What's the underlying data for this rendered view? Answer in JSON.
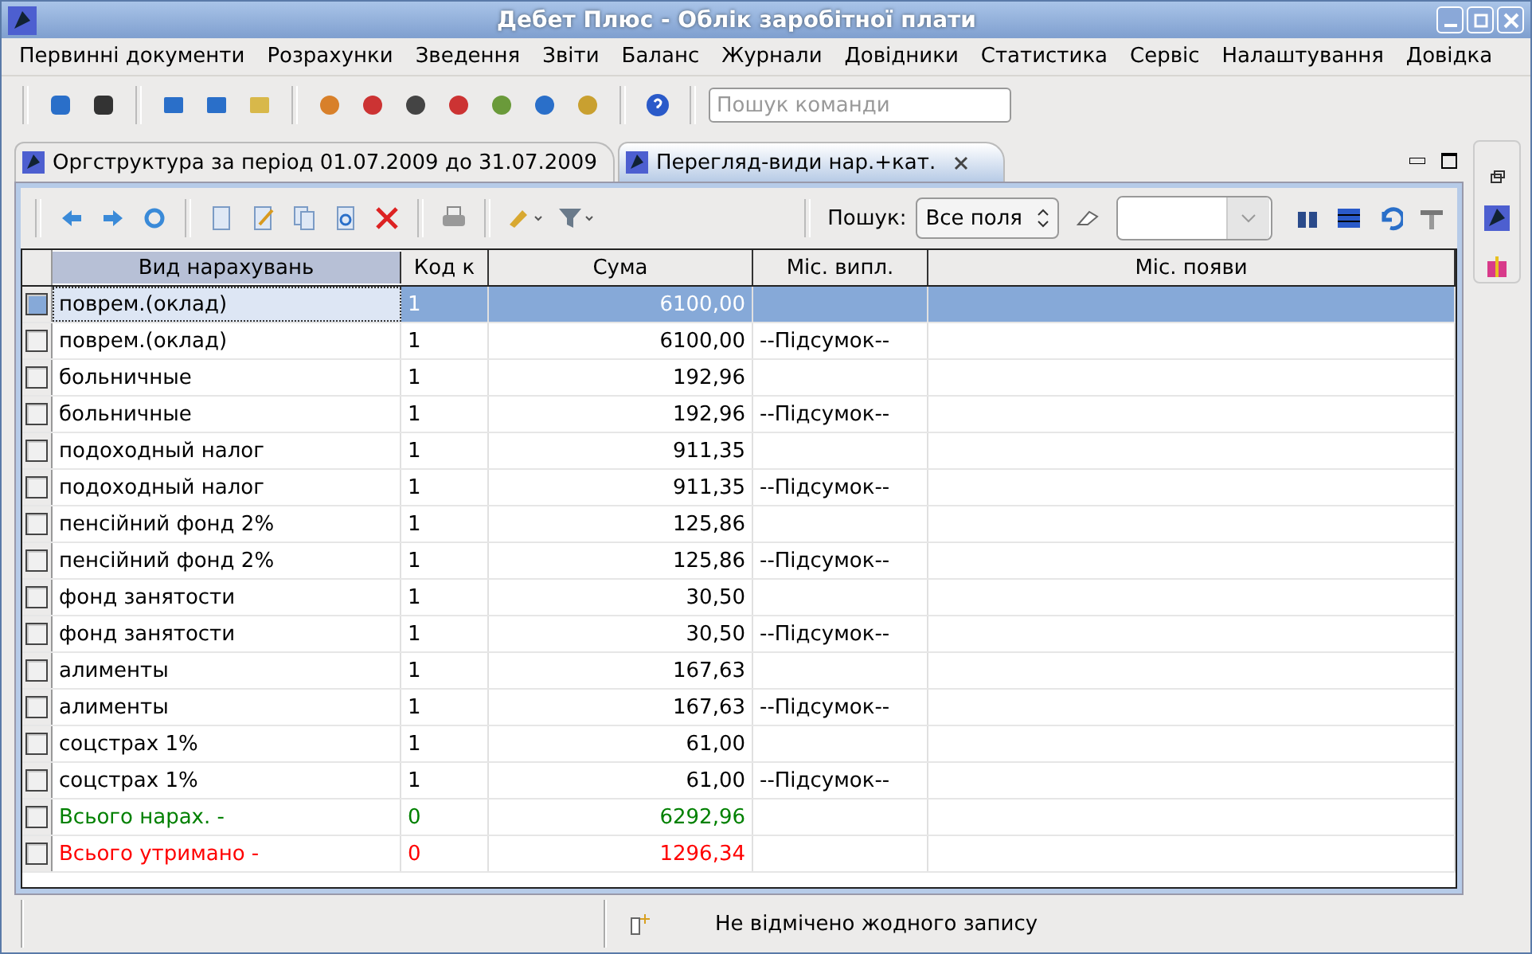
{
  "window": {
    "title": "Дебет Плюс - Облік заробітної плати"
  },
  "menu": [
    "Первинні документи",
    "Розрахунки",
    "Зведення",
    "Звіти",
    "Баланс",
    "Журнали",
    "Довідники",
    "Статистика",
    "Сервіс",
    "Налаштування",
    "Довідка"
  ],
  "command_search": {
    "placeholder": "Пошук команди"
  },
  "tabs": [
    {
      "label": "Оргструктура за період 01.07.2009 до 31.07.2009",
      "selected": false,
      "closable": false
    },
    {
      "label": "Перегляд-види нар.+кат.",
      "selected": true,
      "closable": true
    }
  ],
  "search": {
    "label": "Пошук:",
    "scope": "Все поля"
  },
  "table": {
    "columns": [
      "Вид нарахувань",
      "Код к",
      "Сума",
      "Міс. випл.",
      "Міс. появи"
    ],
    "rows": [
      {
        "name": "поврем.(оклад)",
        "code": "1",
        "sum": "6100,00",
        "month": "",
        "selected": true,
        "color": "#000000"
      },
      {
        "name": "поврем.(оклад)",
        "code": "1",
        "sum": "6100,00",
        "month": "--Підсумок--",
        "selected": false,
        "color": "#000000"
      },
      {
        "name": "больничные",
        "code": "1",
        "sum": "192,96",
        "month": "",
        "selected": false,
        "color": "#000000"
      },
      {
        "name": "больничные",
        "code": "1",
        "sum": "192,96",
        "month": "--Підсумок--",
        "selected": false,
        "color": "#000000"
      },
      {
        "name": "подоходный налог",
        "code": "1",
        "sum": "911,35",
        "month": "",
        "selected": false,
        "color": "#000000"
      },
      {
        "name": "подоходный налог",
        "code": "1",
        "sum": "911,35",
        "month": "--Підсумок--",
        "selected": false,
        "color": "#000000"
      },
      {
        "name": "пенсійний фонд 2%",
        "code": "1",
        "sum": "125,86",
        "month": "",
        "selected": false,
        "color": "#000000"
      },
      {
        "name": "пенсійний фонд 2%",
        "code": "1",
        "sum": "125,86",
        "month": "--Підсумок--",
        "selected": false,
        "color": "#000000"
      },
      {
        "name": "фонд занятости",
        "code": "1",
        "sum": "30,50",
        "month": "",
        "selected": false,
        "color": "#000000"
      },
      {
        "name": "фонд занятости",
        "code": "1",
        "sum": "30,50",
        "month": "--Підсумок--",
        "selected": false,
        "color": "#000000"
      },
      {
        "name": "алименты",
        "code": "1",
        "sum": "167,63",
        "month": "",
        "selected": false,
        "color": "#000000"
      },
      {
        "name": "алименты",
        "code": "1",
        "sum": "167,63",
        "month": "--Підсумок--",
        "selected": false,
        "color": "#000000"
      },
      {
        "name": "соцстрах 1%",
        "code": "1",
        "sum": "61,00",
        "month": "",
        "selected": false,
        "color": "#000000"
      },
      {
        "name": "соцстрах 1%",
        "code": "1",
        "sum": "61,00",
        "month": "--Підсумок--",
        "selected": false,
        "color": "#000000"
      },
      {
        "name": "Всього нарах. -",
        "code": "0",
        "sum": "6292,96",
        "month": "",
        "selected": false,
        "color": "#008000"
      },
      {
        "name": "Всього утримано -",
        "code": "0",
        "sum": "1296,34",
        "month": "",
        "selected": false,
        "color": "#ff0000"
      }
    ]
  },
  "status_bar": {
    "message": "Не відмічено жодного запису"
  }
}
